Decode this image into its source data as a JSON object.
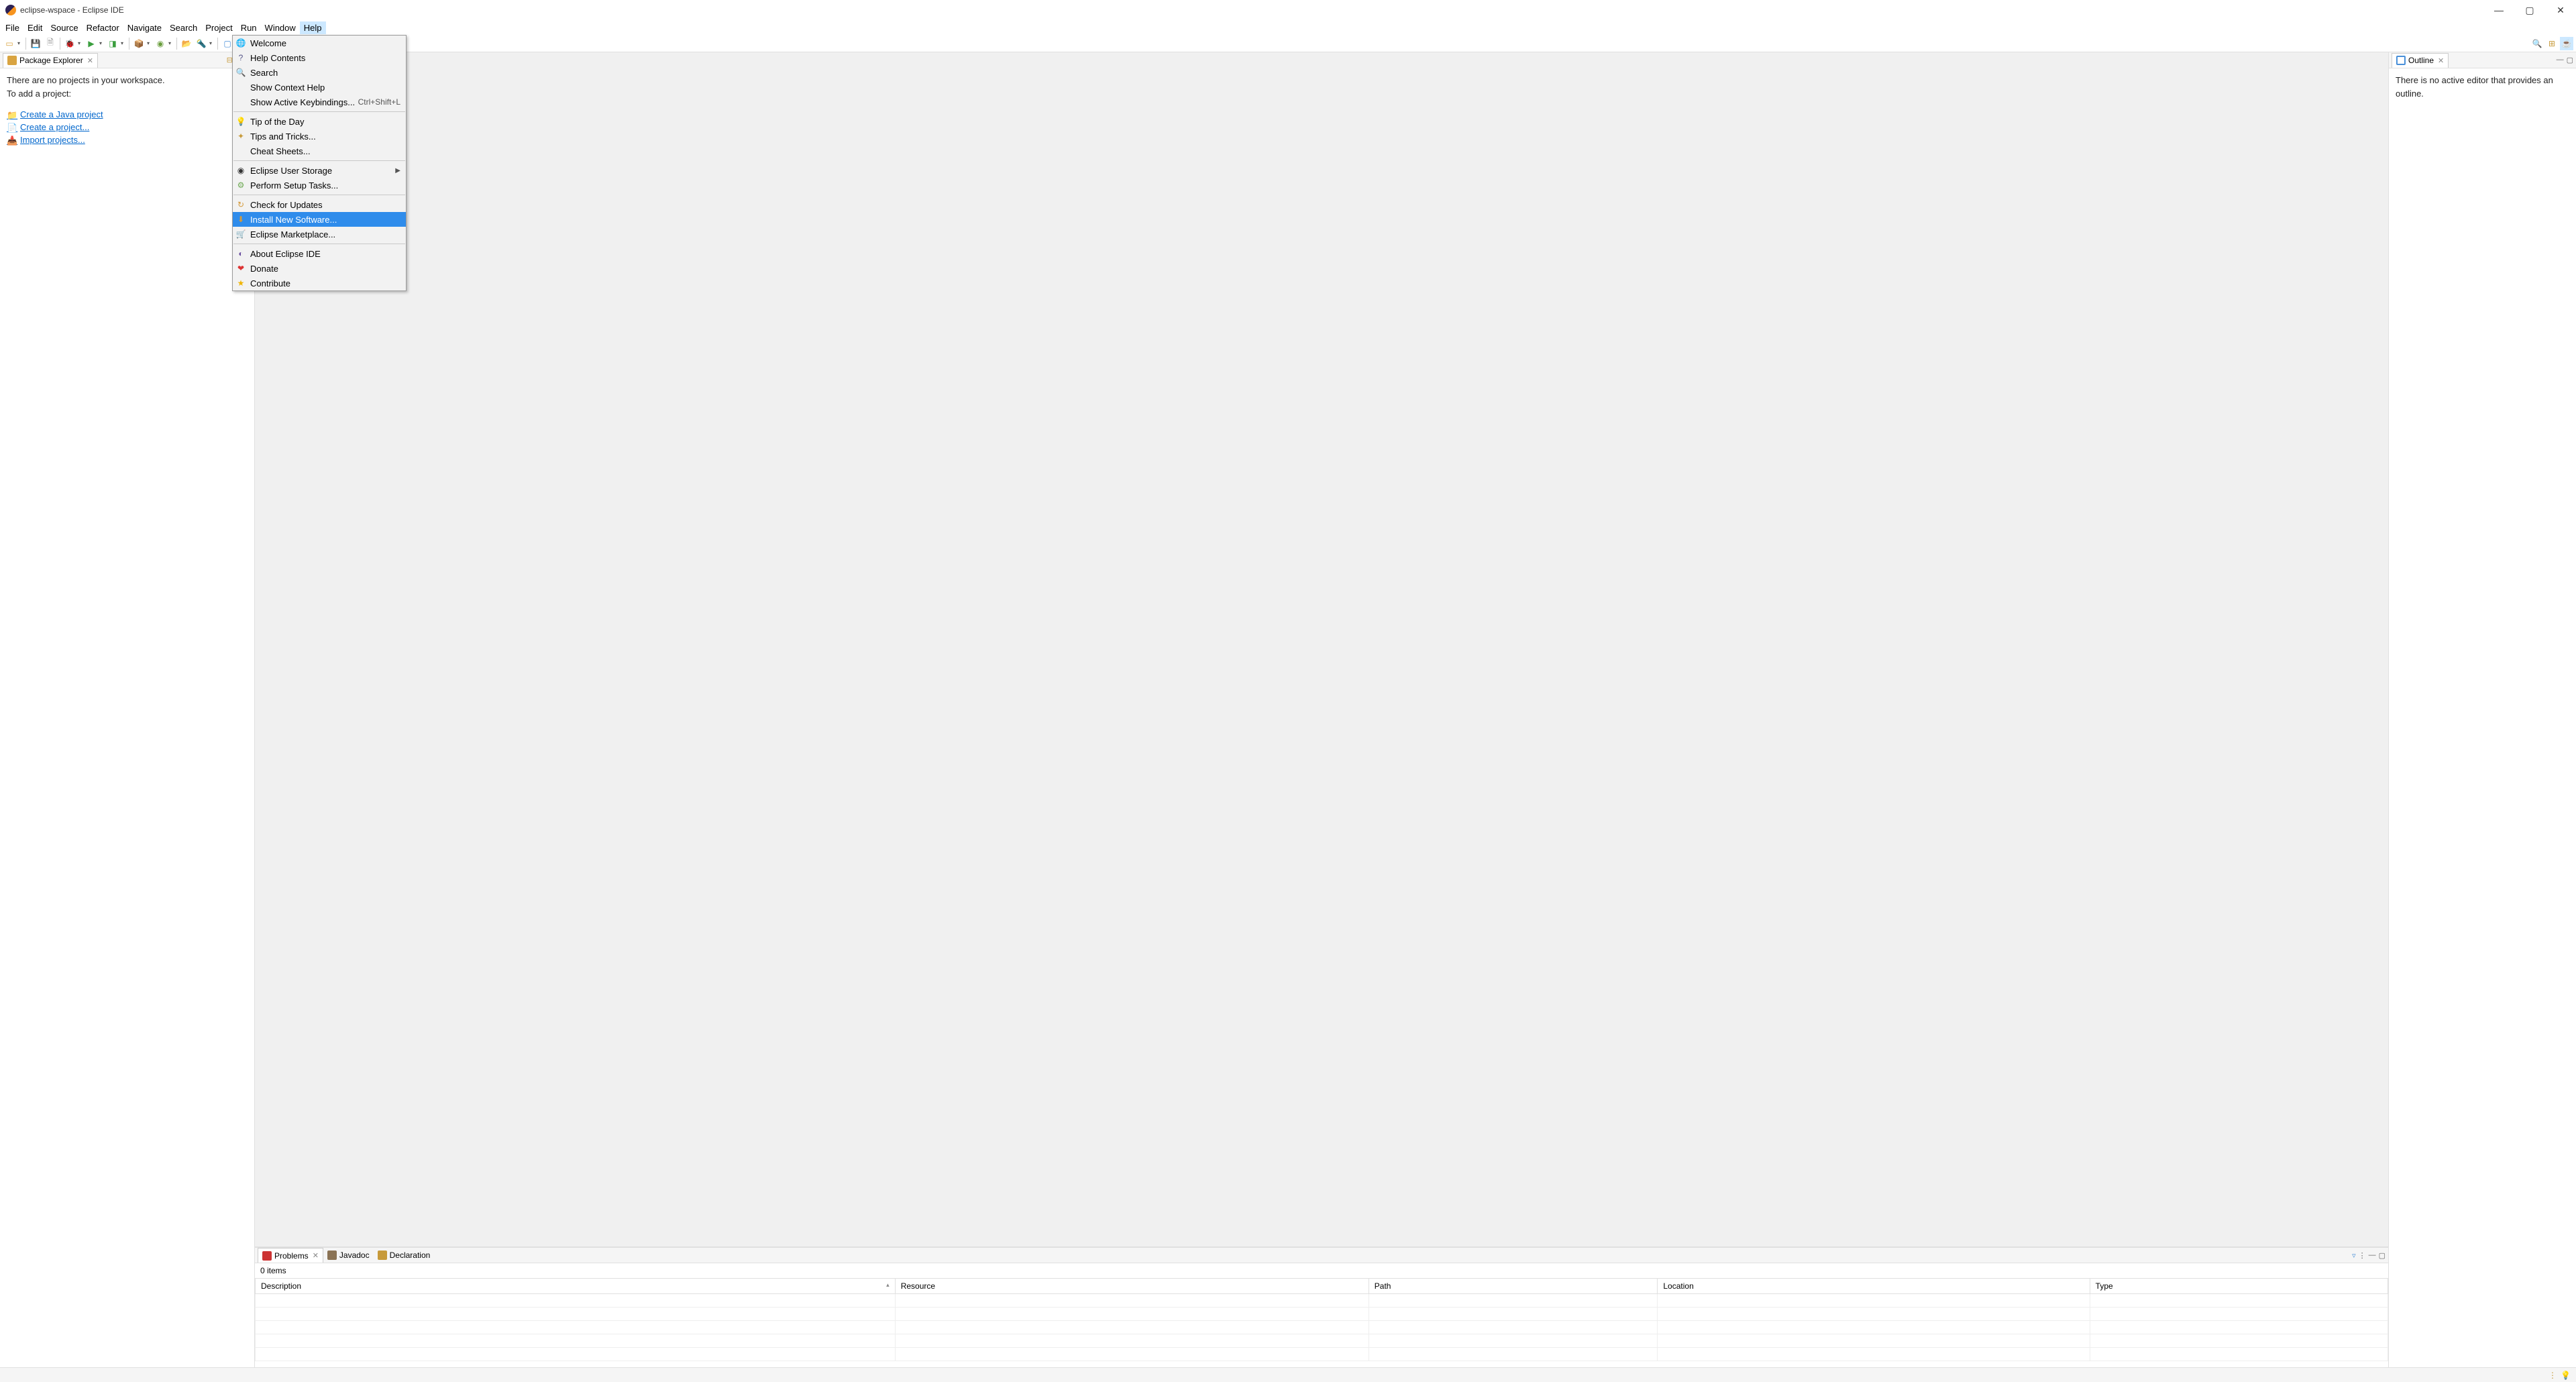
{
  "title": "eclipse-wspace - Eclipse IDE",
  "menubar": [
    "File",
    "Edit",
    "Source",
    "Refactor",
    "Navigate",
    "Search",
    "Project",
    "Run",
    "Window",
    "Help"
  ],
  "menubar_open_index": 9,
  "help_menu": {
    "groups": [
      [
        {
          "icon": "globe-icon",
          "label": "Welcome",
          "color": "#3a7"
        },
        {
          "icon": "help-icon",
          "label": "Help Contents",
          "color": "#558"
        },
        {
          "icon": "search-icon",
          "label": "Search",
          "color": "#888"
        },
        {
          "icon": "",
          "label": "Show Context Help"
        },
        {
          "icon": "",
          "label": "Show Active Keybindings...",
          "shortcut": "Ctrl+Shift+L"
        }
      ],
      [
        {
          "icon": "bulb-icon",
          "label": "Tip of the Day",
          "color": "#e6c04b"
        },
        {
          "icon": "tips-icon",
          "label": "Tips and Tricks...",
          "color": "#c79a3a"
        },
        {
          "icon": "",
          "label": "Cheat Sheets..."
        }
      ],
      [
        {
          "icon": "storage-icon",
          "label": "Eclipse User Storage",
          "color": "#333",
          "submenu": true
        },
        {
          "icon": "setup-icon",
          "label": "Perform Setup Tasks...",
          "color": "#6aa84f"
        }
      ],
      [
        {
          "icon": "update-icon",
          "label": "Check for Updates",
          "color": "#d49a3a"
        },
        {
          "icon": "install-icon",
          "label": "Install New Software...",
          "color": "#d49a3a",
          "highlighted": true
        },
        {
          "icon": "market-icon",
          "label": "Eclipse Marketplace...",
          "color": "#5a8"
        }
      ],
      [
        {
          "icon": "eclipse-icon",
          "label": "About Eclipse IDE",
          "color": "#6a4fa0"
        },
        {
          "icon": "heart-icon",
          "label": "Donate",
          "color": "#d33"
        },
        {
          "icon": "star-icon",
          "label": "Contribute",
          "color": "#f0b400"
        }
      ]
    ]
  },
  "package_explorer": {
    "title": "Package Explorer",
    "msg1": "There are no projects in your workspace.",
    "msg2": "To add a project:",
    "links": [
      {
        "icon": "java-proj-icon",
        "label": "Create a Java project",
        "color": "#c79a3a"
      },
      {
        "icon": "new-proj-icon",
        "label": "Create a project...",
        "color": "#d9a441"
      },
      {
        "icon": "import-icon",
        "label": "Import projects...",
        "color": "#4a90d9"
      }
    ]
  },
  "outline": {
    "title": "Outline",
    "msg": "There is no active editor that provides an outline."
  },
  "bottom": {
    "tabs": [
      {
        "icon": "problems-icon",
        "label": "Problems",
        "active": true
      },
      {
        "icon": "javadoc-icon",
        "label": "Javadoc"
      },
      {
        "icon": "declaration-icon",
        "label": "Declaration"
      }
    ],
    "items_count": "0 items",
    "columns": [
      "Description",
      "Resource",
      "Path",
      "Location",
      "Type"
    ]
  }
}
